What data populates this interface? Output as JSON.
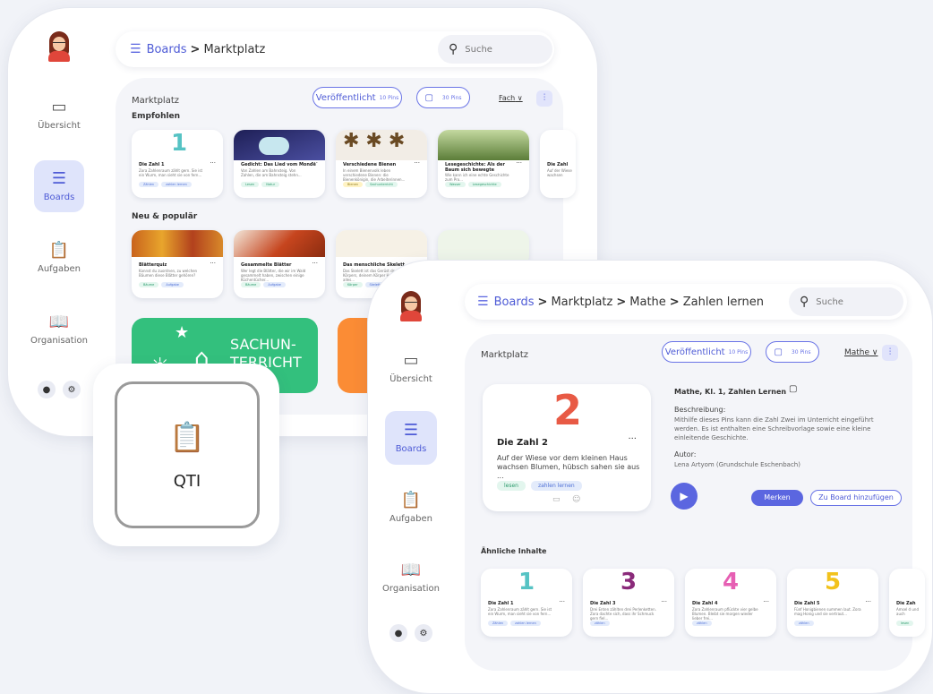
{
  "back": {
    "breadcrumb": {
      "boards": "Boards",
      "sep": ">",
      "current": "Marktplatz"
    },
    "search_placeholder": "Suche",
    "nav": [
      {
        "label": "Übersicht",
        "icon": "layout-icon"
      },
      {
        "label": "Boards",
        "icon": "stack-icon"
      },
      {
        "label": "Aufgaben",
        "icon": "clipboard-icon"
      },
      {
        "label": "Organisation",
        "icon": "book-icon"
      }
    ],
    "heading": "Marktplatz",
    "published": {
      "label": "Veröffentlicht",
      "count": "10 Pins"
    },
    "pins": "30 Pins",
    "filter": "Fach",
    "sections": {
      "recommended": "Empfohlen",
      "new": "Neu & populär"
    },
    "recommended_cards": [
      {
        "title": "Die Zahl 1",
        "desc": "Zora Zahlenraum zählt gern. Sie ist ein Wurm, man sieht sie von fern...",
        "tags": [
          "Zählen",
          "zahlen lernen"
        ]
      },
      {
        "title": "Gedicht: Das Lied vom Monde",
        "desc": "Von Zahlen am Bahnsteig. Von Zahlen, die am Bahnsteig stehn...",
        "tags": [
          "Lesen",
          "Natur"
        ]
      },
      {
        "title": "Verschiedene Bienen",
        "desc": "In einem Bienenvolk leben verschiedene Bienen: die Bienenkönigin, die Arbeiterinnen...",
        "tags": [
          "Bienen",
          "Sachunterricht"
        ]
      },
      {
        "title": "Lesegeschichte: Als der Baum sich bewegte",
        "desc": "Wie kann ich eine echte Geschichte zum Pro...",
        "tags": [
          "Wasser",
          "Lesegeschichte"
        ]
      },
      {
        "title": "Die Zahl",
        "desc": "Auf der Wiese wachsen",
        "tags": []
      }
    ],
    "new_cards": [
      {
        "title": "Blätterquiz",
        "desc": "Kannst du zuordnen, zu welchen Bäumen diese Blätter gehören?",
        "tags": [
          "Bäume",
          "Aufgabe"
        ]
      },
      {
        "title": "Gesammelte Blätter",
        "desc": "Wer legt die Blätter, die wir im Wald gesammelt haben, zwischen einige Küchentücher...",
        "tags": [
          "Bäume",
          "Aufgabe"
        ]
      },
      {
        "title": "Das menschliche Skelett",
        "desc": "Das Skelett ist das Gerüst des Körpers, deinem Körper Halt, trägt alles...",
        "tags": [
          "Körper",
          "Skelett"
        ]
      }
    ],
    "subject_tile": "SACHUN-\nTERRICHT"
  },
  "qti": {
    "label": "QTI"
  },
  "front": {
    "breadcrumb": {
      "boards": "Boards",
      "sep": ">",
      "marktplatz": "Marktplatz",
      "mathe": "Mathe",
      "current": "Zahlen lernen"
    },
    "search_placeholder": "Suche",
    "nav": [
      {
        "label": "Übersicht"
      },
      {
        "label": "Boards"
      },
      {
        "label": "Aufgaben"
      },
      {
        "label": "Organisation"
      }
    ],
    "heading": "Marktplatz",
    "published": {
      "label": "Veröffentlicht",
      "count": "10 Pins"
    },
    "pins": "30 Pins",
    "filter": "Mathe",
    "pin": {
      "title": "Die Zahl 2",
      "desc": "Auf der Wiese vor dem kleinen Haus wachsen Blumen, hübsch sahen sie aus ...",
      "tags": [
        "lesen",
        "zahlen lernen"
      ]
    },
    "detail": {
      "meta": "Mathe, Kl. 1, Zahlen Lernen",
      "desc_label": "Beschreibung:",
      "desc": "Mithilfe dieses Pins kann die Zahl Zwei im Unterricht eingeführt werden. Es ist enthalten eine Schreibvorlage sowie eine kleine einleitende Geschichte.",
      "author_label": "Autor:",
      "author": "Lena Artyom (Grundschule Eschenbach)",
      "save": "Merken",
      "add": "Zu Board hinzufügen"
    },
    "similar_label": "Ähnliche Inhalte",
    "similar": [
      {
        "title": "Die Zahl 1",
        "digit": "1",
        "desc": "Zora Zahlenraum zählt gern. Sie ist ein Wurm, man sieht sie von fern...",
        "tags": [
          "Zählen",
          "zahlen lernen"
        ]
      },
      {
        "title": "Die Zahl 3",
        "digit": "3",
        "desc": "Drei Enten zählten drei Perlenketten. Zora dachte sich, dass ihr Schmuck gern fiel...",
        "tags": [
          "zählen"
        ]
      },
      {
        "title": "Die Zahl 4",
        "digit": "4",
        "desc": "Zora Zahlenraum pflückte vier gelbe Blumen. Bleibt sie morgen wieder lieber frei...",
        "tags": [
          "zählen"
        ]
      },
      {
        "title": "Die Zahl 5",
        "digit": "5",
        "desc": "Fünf Honigbienen summen laut. Zora mag Honig und sie vertraut...",
        "tags": [
          "zählen"
        ]
      },
      {
        "title": "Die Zah",
        "digit": "",
        "desc": "Amsel d und auch",
        "tags": [
          "lesen"
        ]
      }
    ]
  },
  "colors": {
    "accent": "#5b66e0",
    "green": "#3cc17f",
    "orange": "#fb8c35"
  }
}
